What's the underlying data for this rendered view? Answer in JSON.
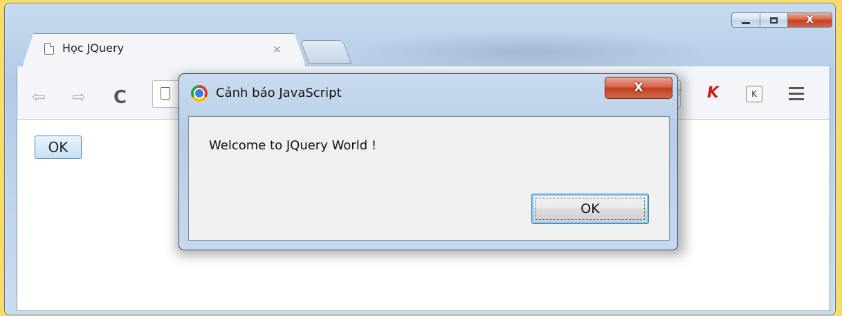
{
  "window": {
    "minimize_glyph": "",
    "close_label": "X"
  },
  "tabs": [
    {
      "title": "Học JQuery",
      "close_label": "×"
    }
  ],
  "toolbar": {
    "back_label": "⇦",
    "forward_label": "⇨",
    "reload_label": "C",
    "menu_icon": "hamburger-menu-icon",
    "extension_k_label": "K"
  },
  "page": {
    "button_label": "OK"
  },
  "dialog": {
    "title": "Cảnh báo JavaScript",
    "close_label": "X",
    "message": "Welcome to JQuery World !",
    "ok_label": "OK"
  },
  "colors": {
    "background": "#f7dc6a",
    "close_red": "#c6401f",
    "focus_blue": "#3c7fb1"
  }
}
